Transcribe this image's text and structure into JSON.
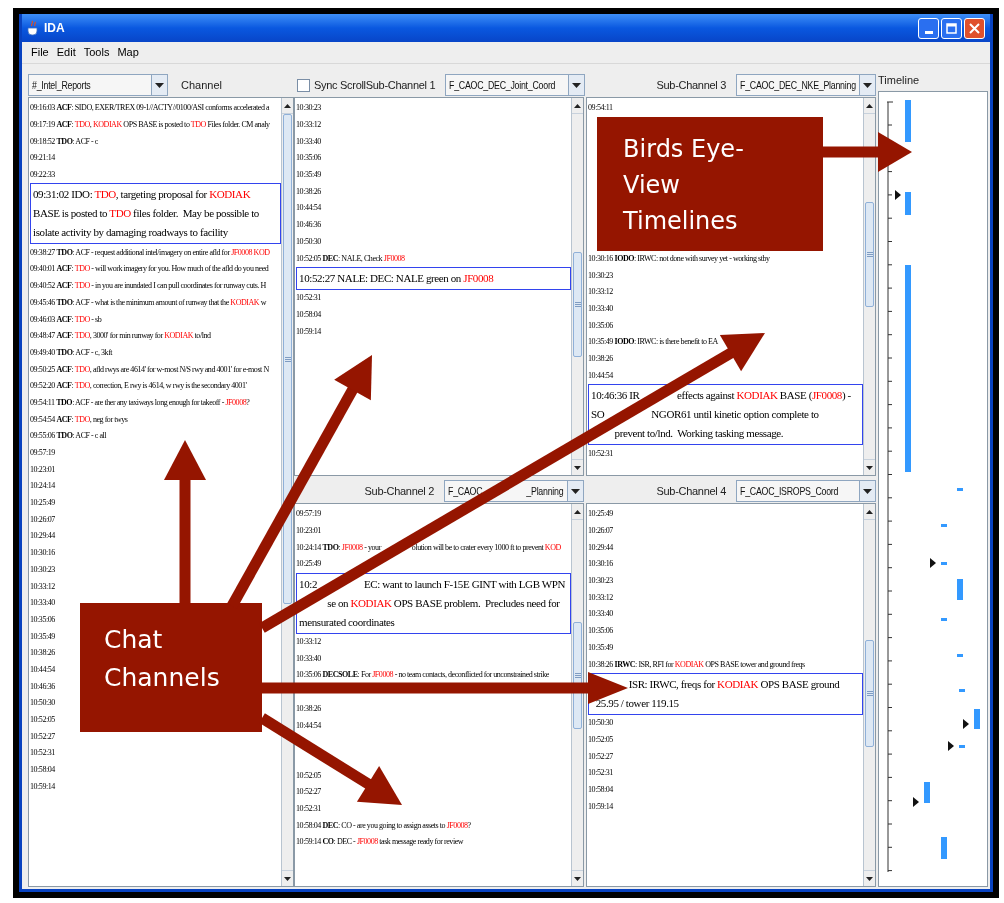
{
  "window": {
    "title": "IDA"
  },
  "menu": [
    "File",
    "Edit",
    "Tools",
    "Map"
  ],
  "channel": {
    "dropdown": "#_Intel_Reports",
    "label": "Channel",
    "callout": "Chat Channels",
    "messages": [
      {
        "kind": "line",
        "time": "09:16:03",
        "sender": "ACF",
        "parts": [
          {
            "text": ": SIDO, EXER/TREX 09-1//ACTY//0100/ASI conforms accelerated a"
          }
        ]
      },
      {
        "kind": "line",
        "time": "09:17:19",
        "sender": "ACF",
        "parts": [
          {
            "text": ": "
          },
          {
            "text": "TDO",
            "kind": "tag"
          },
          {
            "text": ", "
          },
          {
            "text": "KODIAK",
            "kind": "tag"
          },
          {
            "text": " OPS BASE is posted to "
          },
          {
            "text": "TDO",
            "kind": "tag"
          },
          {
            "text": " Files folder. CM analy"
          }
        ]
      },
      {
        "kind": "line",
        "time": "09:18:52",
        "sender": "TDO",
        "parts": [
          {
            "text": ": ACF - c"
          }
        ]
      },
      {
        "kind": "line",
        "time": "09:21:14"
      },
      {
        "kind": "line",
        "time": "09:22:33"
      },
      {
        "kind": "expanded",
        "time": "09:31:02",
        "sender": "IDO",
        "parts": [
          {
            "text": ": "
          },
          {
            "text": "TDO",
            "kind": "tag"
          },
          {
            "text": ", targeting proposal for "
          },
          {
            "text": "KODIAK",
            "kind": "tag"
          },
          {
            "text": " BASE is posted to "
          },
          {
            "text": "TDO",
            "kind": "tag"
          },
          {
            "text": " files folder.  May be possible to isolate activity by damaging roadways to facility"
          }
        ]
      },
      {
        "kind": "line",
        "time": "09:38:27",
        "sender": "TDO",
        "parts": [
          {
            "text": ": ACF - request additional intel/imagery on entire afld for "
          },
          {
            "text": "JF0008 KOD",
            "kind": "tag"
          }
        ]
      },
      {
        "kind": "line",
        "time": "09:40:01",
        "sender": "ACF",
        "parts": [
          {
            "text": ": "
          },
          {
            "text": "TDO",
            "kind": "tag"
          },
          {
            "text": " - will work imagery for you. How much of the afld do you need"
          }
        ]
      },
      {
        "kind": "line",
        "time": "09:40:52",
        "sender": "ACF",
        "parts": [
          {
            "text": ": "
          },
          {
            "text": "TDO",
            "kind": "tag"
          },
          {
            "text": " - in you are inundated I can pull coordinates for runway cuts. H"
          }
        ]
      },
      {
        "kind": "line",
        "time": "09:45:46",
        "sender": "TDO",
        "parts": [
          {
            "text": ": ACF - what is the minimum amount of runway that the "
          },
          {
            "text": "KODIAK",
            "kind": "tag"
          },
          {
            "text": " w"
          }
        ]
      },
      {
        "kind": "line",
        "time": "09:46:03",
        "sender": "ACF",
        "parts": [
          {
            "text": ": "
          },
          {
            "text": "TDO",
            "kind": "tag"
          },
          {
            "text": " - sb"
          }
        ]
      },
      {
        "kind": "line",
        "time": "09:48:47",
        "sender": "ACF",
        "parts": [
          {
            "text": ": "
          },
          {
            "text": "TDO",
            "kind": "tag"
          },
          {
            "text": ", 3000' for min runway for "
          },
          {
            "text": "KODIAK",
            "kind": "tag"
          },
          {
            "text": " to/lnd"
          }
        ]
      },
      {
        "kind": "line",
        "time": "09:49:40",
        "sender": "TDO",
        "parts": [
          {
            "text": ": ACF - c, 3kft"
          }
        ]
      },
      {
        "kind": "line",
        "time": "09:50:25",
        "sender": "ACF",
        "parts": [
          {
            "text": ": "
          },
          {
            "text": "TDO",
            "kind": "tag"
          },
          {
            "text": ", afld rwys are 4614' for w-most N/S rwy and 4001' for e-most N"
          }
        ]
      },
      {
        "kind": "line",
        "time": "09:52:20",
        "sender": "ACF",
        "parts": [
          {
            "text": ": "
          },
          {
            "text": "TDO",
            "kind": "tag"
          },
          {
            "text": ", correction, E rwy is 4614, w rwy is the secondary 4001'"
          }
        ]
      },
      {
        "kind": "line",
        "time": "09:54:11",
        "sender": "TDO",
        "parts": [
          {
            "text": ": ACF - are ther any taxiways long enough for takeoff - "
          },
          {
            "text": "JF0008",
            "kind": "tag"
          },
          {
            "text": "?"
          }
        ]
      },
      {
        "kind": "line",
        "time": "09:54:54",
        "sender": "ACF",
        "parts": [
          {
            "text": ": "
          },
          {
            "text": "TDO",
            "kind": "tag"
          },
          {
            "text": ", neg for twys"
          }
        ]
      },
      {
        "kind": "line",
        "time": "09:55:06",
        "sender": "TDO",
        "parts": [
          {
            "text": ": ACF - c all"
          }
        ]
      },
      {
        "kind": "line",
        "time": "09:57:19"
      },
      {
        "kind": "line",
        "time": "10:23:01"
      },
      {
        "kind": "line",
        "time": "10:24:14"
      },
      {
        "kind": "line",
        "time": "10:25:49"
      },
      {
        "kind": "line",
        "time": "10:26:07"
      },
      {
        "kind": "line",
        "time": "10:29:44"
      },
      {
        "kind": "line",
        "time": "10:30:16"
      },
      {
        "kind": "line",
        "time": "10:30:23"
      },
      {
        "kind": "line",
        "time": "10:33:12"
      },
      {
        "kind": "line",
        "time": "10:33:40"
      },
      {
        "kind": "line",
        "time": "10:35:06"
      },
      {
        "kind": "line",
        "time": "10:35:49"
      },
      {
        "kind": "line",
        "time": "10:38:26"
      },
      {
        "kind": "line",
        "time": "10:44:54"
      },
      {
        "kind": "line",
        "time": "10:46:36"
      },
      {
        "kind": "line",
        "time": "10:50:30"
      },
      {
        "kind": "line",
        "time": "10:52:05"
      },
      {
        "kind": "line",
        "time": "10:52:27"
      },
      {
        "kind": "line",
        "time": "10:52:31"
      },
      {
        "kind": "line",
        "time": "10:58:04"
      },
      {
        "kind": "line",
        "time": "10:59:14"
      }
    ]
  },
  "sync_scroll": {
    "label": "Sync Scroll",
    "checked": false
  },
  "sub_channels": [
    {
      "label": "Sub-Channel 1",
      "dropdown": "F_CAOC_DEC_Joint_Coord",
      "messages": [
        {
          "kind": "line",
          "time": "10:30:23"
        },
        {
          "kind": "line",
          "time": "10:33:12"
        },
        {
          "kind": "line",
          "time": "10:33:40"
        },
        {
          "kind": "line",
          "time": "10:35:06"
        },
        {
          "kind": "line",
          "time": "10:35:49"
        },
        {
          "kind": "line",
          "time": "10:38:26"
        },
        {
          "kind": "line",
          "time": "10:44:54"
        },
        {
          "kind": "line",
          "time": "10:46:36"
        },
        {
          "kind": "line",
          "time": "10:50:30"
        },
        {
          "kind": "line",
          "time": "10:52:05",
          "sender": "DEC",
          "parts": [
            {
              "text": ": NALE, Check "
            },
            {
              "text": "JF0008",
              "kind": "tag"
            }
          ]
        },
        {
          "kind": "expanded",
          "time": "10:52:27",
          "sender": "NALE",
          "parts": [
            {
              "text": ": DEC: NALE green on "
            },
            {
              "text": "JF0008",
              "kind": "tag"
            }
          ]
        },
        {
          "kind": "line",
          "time": "10:52:31"
        },
        {
          "kind": "line",
          "time": "10:58:04"
        },
        {
          "kind": "line",
          "time": "10:59:14"
        }
      ]
    },
    {
      "label": "Sub-Channel 2",
      "dropdown": "F_CAOC                    _Planning",
      "messages": [
        {
          "kind": "line",
          "time": "09:57:19"
        },
        {
          "kind": "line",
          "time": "10:23:01"
        },
        {
          "kind": "line",
          "time": "10:24:14",
          "sender": "TDO",
          "parts": [
            {
              "text": ": "
            },
            {
              "text": "JF0008",
              "kind": "tag"
            },
            {
              "text": " - your                    olution will be to crater every 1000 ft to prevent "
            },
            {
              "text": "KOD",
              "kind": "tag"
            }
          ]
        },
        {
          "kind": "line",
          "time": "10:25:49"
        },
        {
          "kind": "expanded",
          "time": "10:2",
          "parts": [
            {
              "text": "                    EC: want to launch F-15E GINT with LGB WPN\n            se on "
            },
            {
              "text": "KODIAK",
              "kind": "tag"
            },
            {
              "text": " OPS BASE problem.  Precludes need for\nmensurated coordinates"
            }
          ]
        },
        {
          "kind": "line",
          "time": "10:33:12"
        },
        {
          "kind": "line",
          "time": "10:33:40"
        },
        {
          "kind": "line",
          "time": "10:35:06",
          "sender": "DECSOLE",
          "parts": [
            {
              "text": ": For "
            },
            {
              "text": "JF0008",
              "kind": "tag"
            },
            {
              "text": " - no team contacts, deconflicted for unconstrained strike"
            }
          ]
        },
        {
          "kind": "covered"
        },
        {
          "kind": "line",
          "time": "10:38:26"
        },
        {
          "kind": "line",
          "time": "10:44:54"
        },
        {
          "kind": "covered"
        },
        {
          "kind": "covered"
        },
        {
          "kind": "line",
          "time": "10:52:05"
        },
        {
          "kind": "line",
          "time": "10:52:27"
        },
        {
          "kind": "line",
          "time": "10:52:31"
        },
        {
          "kind": "line",
          "time": "10:58:04",
          "sender": "DEC",
          "parts": [
            {
              "text": ": CO - are you going to assign assets to "
            },
            {
              "text": "JF0008",
              "kind": "tag"
            },
            {
              "text": "?"
            }
          ]
        },
        {
          "kind": "line",
          "time": "10:59:14",
          "sender": "CO",
          "parts": [
            {
              "text": ": DEC - "
            },
            {
              "text": "JF0008",
              "kind": "tag"
            },
            {
              "text": " task message ready for review"
            }
          ]
        }
      ]
    },
    {
      "label": "Sub-Channel 3",
      "dropdown": "F_CAOC_DEC_NKE_Planning",
      "messages": [
        {
          "kind": "line",
          "time": "09:54:11"
        },
        {
          "kind": "callout",
          "text": "Birds Eye-View Timelines"
        },
        {
          "kind": "line",
          "time": "10:30:16",
          "sender": "IODO",
          "parts": [
            {
              "text": ": IRWC: not done with survey yet - working stby"
            }
          ]
        },
        {
          "kind": "line",
          "time": "10:30:23"
        },
        {
          "kind": "line",
          "time": "10:33:12"
        },
        {
          "kind": "line",
          "time": "10:33:40"
        },
        {
          "kind": "line",
          "time": "10:35:06"
        },
        {
          "kind": "line",
          "time": "10:35:49",
          "sender": "IODO",
          "parts": [
            {
              "text": ": IRWC: is there benefit to EA"
            }
          ]
        },
        {
          "kind": "line",
          "time": "10:38:26"
        },
        {
          "kind": "line",
          "time": "10:44:54"
        },
        {
          "kind": "expanded",
          "time": "10:46:36",
          "parts": [
            {
              "text": " IR                effects against "
            },
            {
              "text": "KODIAK",
              "kind": "tag"
            },
            {
              "text": " BASE ("
            },
            {
              "text": "JF0008",
              "kind": "tag"
            },
            {
              "text": ") -\nSO                    NGOR61 until kinetic option complete to\n          prevent to/lnd.  Working tasking message."
            }
          ]
        },
        {
          "kind": "line",
          "time": "10:52:31"
        }
      ]
    },
    {
      "label": "Sub-Channel 4",
      "dropdown": "F_CAOC_ISROPS_Coord",
      "messages": [
        {
          "kind": "line",
          "time": "10:25:49"
        },
        {
          "kind": "line",
          "time": "10:26:07"
        },
        {
          "kind": "line",
          "time": "10:29:44"
        },
        {
          "kind": "line",
          "time": "10:30:16"
        },
        {
          "kind": "line",
          "time": "10:30:23"
        },
        {
          "kind": "line",
          "time": "10:33:12"
        },
        {
          "kind": "line",
          "time": "10:33:40"
        },
        {
          "kind": "line",
          "time": "10:35:06"
        },
        {
          "kind": "line",
          "time": "10:35:49"
        },
        {
          "kind": "line",
          "time": "10:38:26",
          "sender": "IRWC",
          "parts": [
            {
              "text": ": ISR, RFI for "
            },
            {
              "text": "KODIAK",
              "kind": "tag"
            },
            {
              "text": " OPS BASE tower and ground freqs"
            }
          ]
        },
        {
          "kind": "expanded",
          "parts": [
            {
              "text": "                ISR: IRWC, freqs for "
            },
            {
              "text": "KODIAK",
              "kind": "tag"
            },
            {
              "text": " OPS BASE ground\n  25.95 / tower 119.15"
            }
          ]
        },
        {
          "kind": "line",
          "time": "10:50:30"
        },
        {
          "kind": "line",
          "time": "10:52:05"
        },
        {
          "kind": "line",
          "time": "10:52:27"
        },
        {
          "kind": "line",
          "time": "10:52:31"
        },
        {
          "kind": "line",
          "time": "10:58:04"
        },
        {
          "kind": "line",
          "time": "10:59:14"
        }
      ]
    }
  ],
  "timeline": {
    "label": "Timeline"
  }
}
